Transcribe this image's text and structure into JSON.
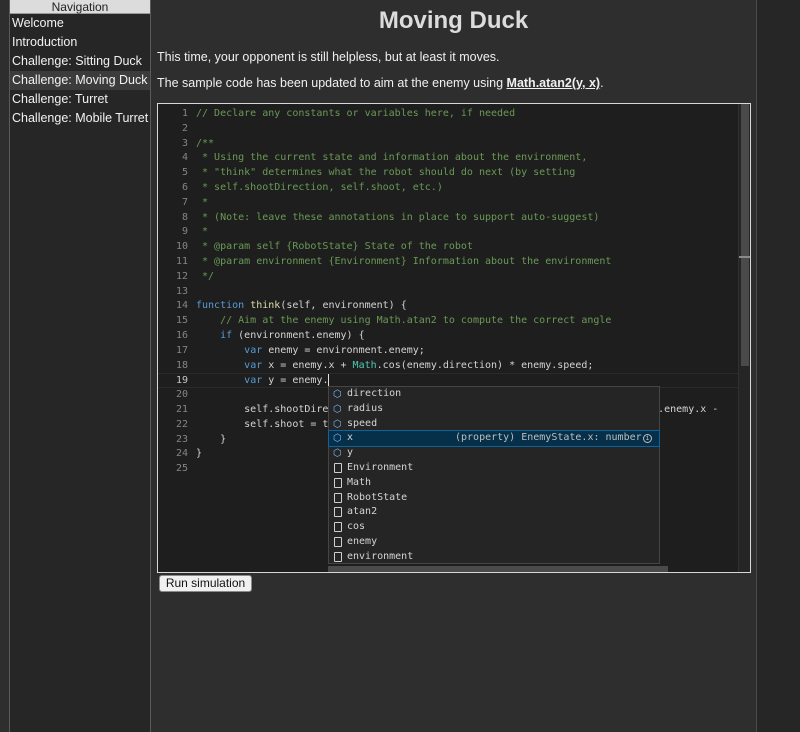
{
  "nav": {
    "header": "Navigation",
    "items": [
      {
        "label": "Welcome",
        "active": false
      },
      {
        "label": "Introduction",
        "active": false
      },
      {
        "label": "Challenge: Sitting Duck",
        "active": false
      },
      {
        "label": "Challenge: Moving Duck",
        "active": true
      },
      {
        "label": "Challenge: Turret",
        "active": false
      },
      {
        "label": "Challenge: Mobile Turret",
        "active": false
      }
    ]
  },
  "page": {
    "title": "Moving Duck",
    "para1": "This time, your opponent is still helpless, but at least it moves.",
    "para2_prefix": "The sample code has been updated to aim at the enemy using ",
    "para2_link": "Math.atan2(y, x)",
    "para2_suffix": "."
  },
  "editor": {
    "current_line": 19,
    "line_numbers": [
      "1",
      "2",
      "3",
      "4",
      "5",
      "6",
      "7",
      "8",
      "9",
      "10",
      "11",
      "12",
      "13",
      "14",
      "15",
      "16",
      "17",
      "18",
      "19",
      "20",
      "21",
      "22",
      "23",
      "24",
      "25"
    ],
    "line_comment": "// Declare any constants or variables here, if needed",
    "doc_open": "/**",
    "doc_1": " * Using the current state and information about the environment,",
    "doc_2": " * \"think\" determines what the robot should do next (by setting",
    "doc_3": " * self.shootDirection, self.shoot, etc.)",
    "doc_4": " *",
    "doc_5": " * (Note: leave these annotations in place to support auto-suggest)",
    "doc_6": " *",
    "doc_7": " * @param self {RobotState} State of the robot",
    "doc_8": " * @param environment {Environment} Information about the environment",
    "doc_close": " */",
    "fn_kw": "function",
    "fn_name": "think",
    "fn_sig": "(self, environment) {",
    "aim_comment": "    // Aim at the enemy using Math.atan2 to compute the correct angle",
    "if_kw": "if",
    "if_rest": " (environment.enemy) {",
    "var_kw": "var",
    "l17_rest": " enemy = environment.enemy;",
    "l18_a": " x = enemy.x + ",
    "l18_math": "Math",
    "l18_b": ".cos(enemy.direction) * enemy.speed;",
    "l19_rest": " y = enemy.",
    "l21_a": "        self.shootDire",
    "l21_b": "nment.enemy.x -",
    "l22_a": "        self.shoot = t",
    "close_if": "    }",
    "close_fn": "}"
  },
  "suggest": {
    "items": [
      {
        "label": "direction",
        "kind": "property",
        "selected": false,
        "detail": ""
      },
      {
        "label": "radius",
        "kind": "property",
        "selected": false,
        "detail": ""
      },
      {
        "label": "speed",
        "kind": "property",
        "selected": false,
        "detail": ""
      },
      {
        "label": "x",
        "kind": "property",
        "selected": true,
        "detail": "(property) EnemyState.x: number"
      },
      {
        "label": "y",
        "kind": "property",
        "selected": false,
        "detail": ""
      },
      {
        "label": "Environment",
        "kind": "text",
        "selected": false,
        "detail": ""
      },
      {
        "label": "Math",
        "kind": "text",
        "selected": false,
        "detail": ""
      },
      {
        "label": "RobotState",
        "kind": "text",
        "selected": false,
        "detail": ""
      },
      {
        "label": "atan2",
        "kind": "text",
        "selected": false,
        "detail": ""
      },
      {
        "label": "cos",
        "kind": "text",
        "selected": false,
        "detail": ""
      },
      {
        "label": "enemy",
        "kind": "text",
        "selected": false,
        "detail": ""
      },
      {
        "label": "environment",
        "kind": "text",
        "selected": false,
        "detail": ""
      }
    ]
  },
  "actions": {
    "run_label": "Run simulation"
  },
  "colors": {
    "background": "#2e2e2e",
    "editor_bg": "#1e1e1e",
    "comment": "#6a9955",
    "keyword": "#569cd6",
    "selection": "#062f4a"
  }
}
